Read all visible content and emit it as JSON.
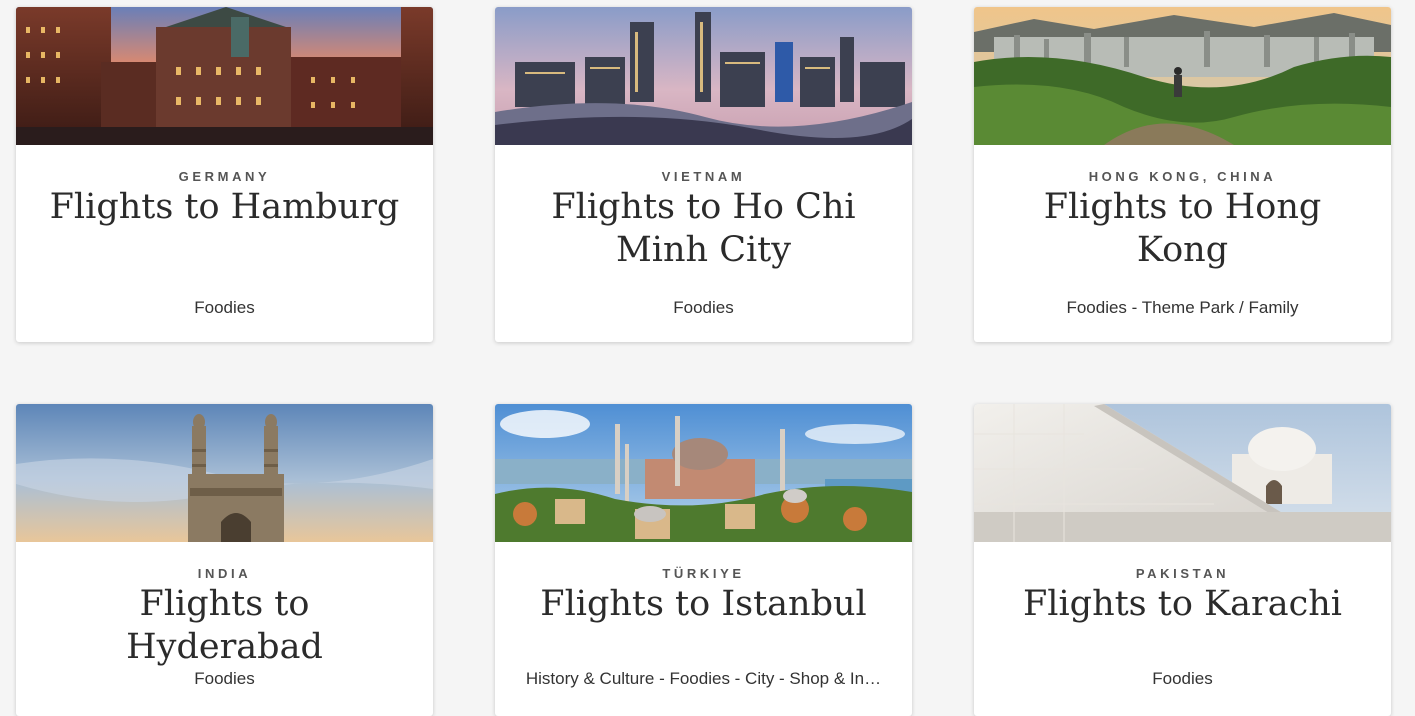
{
  "cards": [
    {
      "country": "Germany",
      "title": "Flights to Hamburg",
      "tags": "Foodies",
      "image_icon": "hamburg-warehouse-district-photo"
    },
    {
      "country": "Vietnam",
      "title": "Flights to Ho Chi Minh City",
      "tags": "Foodies",
      "image_icon": "ho-chi-minh-skyline-photo"
    },
    {
      "country": "Hong Kong, China",
      "title": "Flights to Hong Kong",
      "tags": "Foodies - Theme Park / Family",
      "image_icon": "hong-kong-hiker-photo"
    },
    {
      "country": "India",
      "title": "Flights to Hyderabad",
      "tags": "Foodies",
      "image_icon": "charminar-photo"
    },
    {
      "country": "Türkiye",
      "title": "Flights to Istanbul",
      "tags": "History & Culture - Foodies - City - Shop & In…",
      "image_icon": "hagia-sophia-photo"
    },
    {
      "country": "Pakistan",
      "title": "Flights to Karachi",
      "tags": "Foodies",
      "image_icon": "mazar-e-quaid-photo"
    }
  ]
}
